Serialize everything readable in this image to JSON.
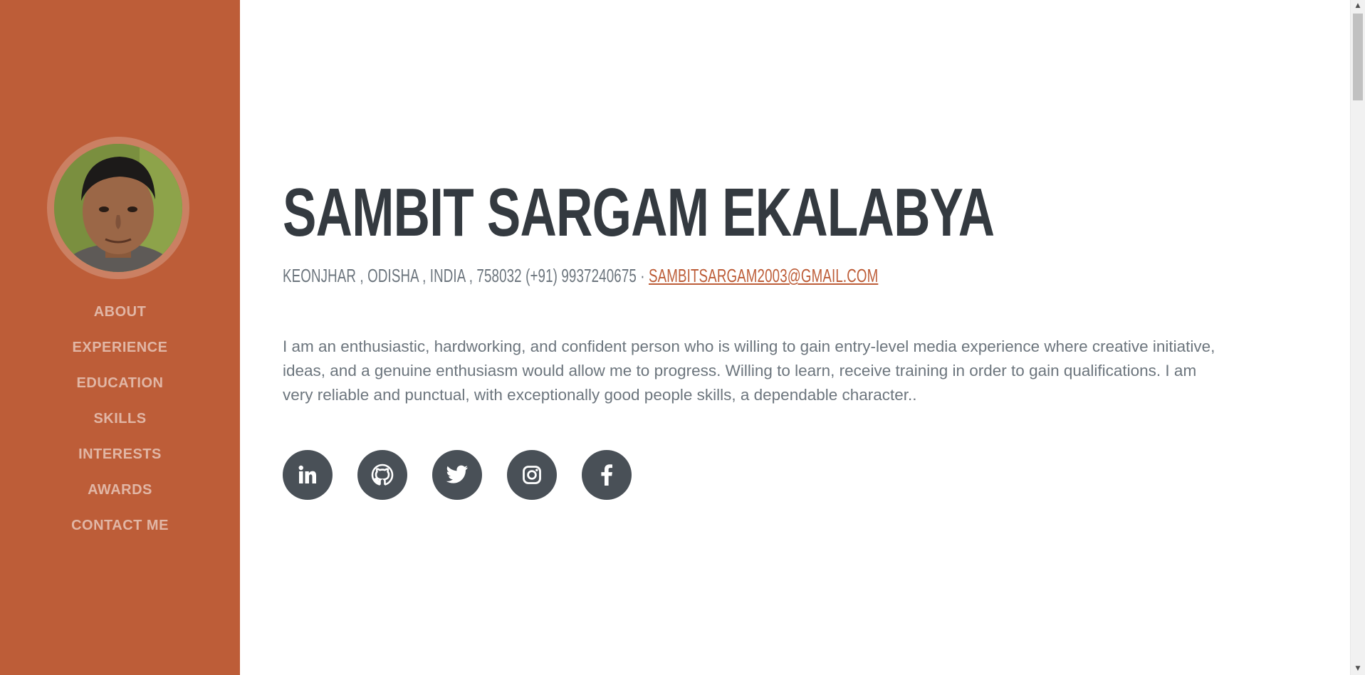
{
  "sidebar": {
    "nav": [
      {
        "label": "ABOUT"
      },
      {
        "label": "EXPERIENCE"
      },
      {
        "label": "EDUCATION"
      },
      {
        "label": "SKILLS"
      },
      {
        "label": "INTERESTS"
      },
      {
        "label": "AWARDS"
      },
      {
        "label": "CONTACT ME"
      }
    ]
  },
  "about": {
    "name": "SAMBIT SARGAM EKALABYA",
    "address": "KEONJHAR , ODISHA , INDIA , 758032 (+91) 9937240675 · ",
    "email": "SAMBITSARGAM2003@GMAIL.COM",
    "bio": "I am an enthusiastic, hardworking, and confident person who is willing to gain entry-level media experience where creative initiative, ideas, and a genuine enthusiasm would allow me to progress. Willing to learn, receive training in order to gain qualifications. I am very reliable and punctual, with exceptionally good people skills, a dependable character..",
    "social": [
      {
        "icon": "linkedin-icon"
      },
      {
        "icon": "github-icon"
      },
      {
        "icon": "twitter-icon"
      },
      {
        "icon": "instagram-icon"
      },
      {
        "icon": "facebook-icon"
      }
    ]
  },
  "colors": {
    "primary": "#bd5d38",
    "heading": "#343a40",
    "text": "#6c757d",
    "social_bg": "#495057"
  }
}
